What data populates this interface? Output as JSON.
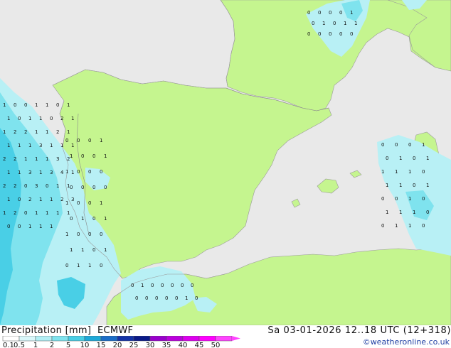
{
  "header": {
    "title": "Precipitation [mm]",
    "model": "ECMWF",
    "datetime": "Sa 03-01-2026 12..18 UTC (12+318)"
  },
  "credit": "©weatheronline.co.uk",
  "colors": {
    "sea": "#e9e9e9",
    "land": "#c5f58f",
    "border": "#9a9a9a",
    "precip_light": "#b8f0f5",
    "precip_mid": "#7fe3ee",
    "precip_heavy": "#49cfe6"
  },
  "legend": {
    "labels": [
      "0.1",
      "0.5",
      "1",
      "2",
      "5",
      "10",
      "15",
      "20",
      "25",
      "30",
      "35",
      "40",
      "45",
      "50"
    ],
    "colors": [
      "#ffffff",
      "#d9f7fa",
      "#b2eff5",
      "#7fe3ee",
      "#49cfe6",
      "#1ea9d8",
      "#1a6dc8",
      "#1433a8",
      "#0b1a88",
      "#9900cc",
      "#bb00dd",
      "#dd00ee",
      "#ff00ff",
      "#ff44ff"
    ]
  },
  "map_labels": {
    "atlantic": [
      "1",
      "0",
      "0",
      "1",
      "1",
      "0",
      "1",
      "1",
      "0",
      "1",
      "1",
      "0",
      "2",
      "1",
      "1",
      "2",
      "2",
      "1",
      "1",
      "2",
      "1",
      "1",
      "1",
      "1",
      "3",
      "1",
      "1",
      "1",
      "2",
      "2",
      "1",
      "1",
      "1",
      "3",
      "2",
      "1",
      "1",
      "3",
      "1",
      "3",
      "4",
      "1",
      "2",
      "2",
      "0",
      "3",
      "0",
      "1",
      "1",
      "1",
      "0",
      "2",
      "1",
      "1",
      "2",
      "3",
      "1",
      "2",
      "0",
      "1",
      "1",
      "1",
      "1",
      "0",
      "0",
      "1",
      "1",
      "1"
    ],
    "coast": [
      "0",
      "0",
      "0",
      "1",
      "1",
      "0",
      "0",
      "1",
      "1",
      "0",
      "0",
      "0",
      "0",
      "0",
      "0",
      "0",
      "1",
      "0",
      "0",
      "1",
      "0",
      "1",
      "0",
      "1",
      "1",
      "0",
      "0",
      "0",
      "1",
      "1",
      "0",
      "1",
      "0",
      "1",
      "1",
      "0"
    ],
    "alps": [
      "0",
      "0",
      "0",
      "0",
      "1",
      "0",
      "1",
      "0",
      "1",
      "1",
      "0",
      "0",
      "0",
      "0",
      "0"
    ],
    "med_east": [
      "0",
      "0",
      "0",
      "1",
      "0",
      "1",
      "0",
      "1",
      "1",
      "1",
      "1",
      "0",
      "1",
      "1",
      "0",
      "1",
      "0",
      "0",
      "1",
      "0",
      "1",
      "1",
      "1",
      "0",
      "0",
      "1",
      "1",
      "0"
    ],
    "africa": [
      "0",
      "1",
      "0",
      "0",
      "0",
      "0",
      "0",
      "0",
      "0",
      "0",
      "0",
      "0",
      "1",
      "0"
    ]
  }
}
